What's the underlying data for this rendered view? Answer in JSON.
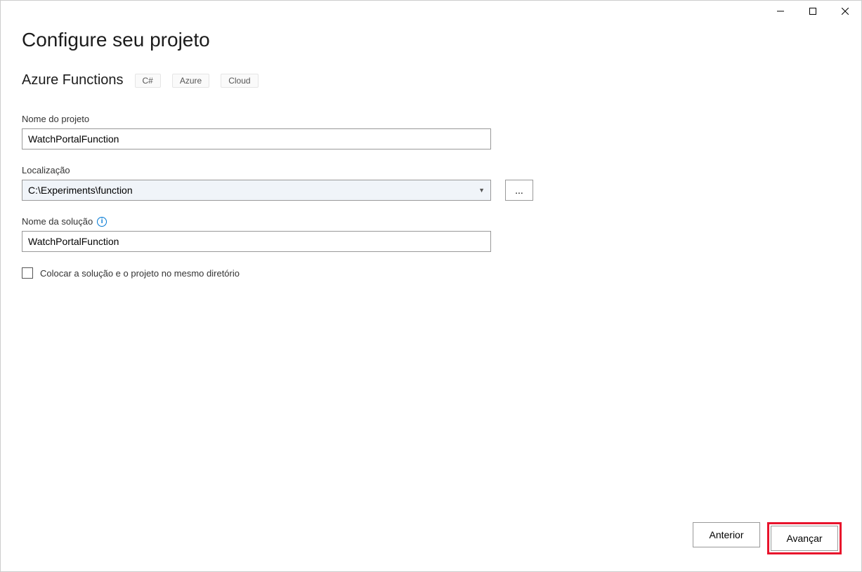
{
  "window": {
    "title": "Configure seu projeto"
  },
  "header": {
    "subtitle": "Azure Functions",
    "tags": [
      "C#",
      "Azure",
      "Cloud"
    ]
  },
  "fields": {
    "projectName": {
      "label": "Nome do projeto",
      "value": "WatchPortalFunction"
    },
    "location": {
      "label": "Localização",
      "value": "C:\\Experiments\\function",
      "browse": "..."
    },
    "solutionName": {
      "label": "Nome da solução",
      "value": "WatchPortalFunction"
    },
    "sameDirectory": {
      "label": "Colocar a solução e o projeto no mesmo diretório"
    }
  },
  "footer": {
    "back": "Anterior",
    "next": "Avançar"
  }
}
